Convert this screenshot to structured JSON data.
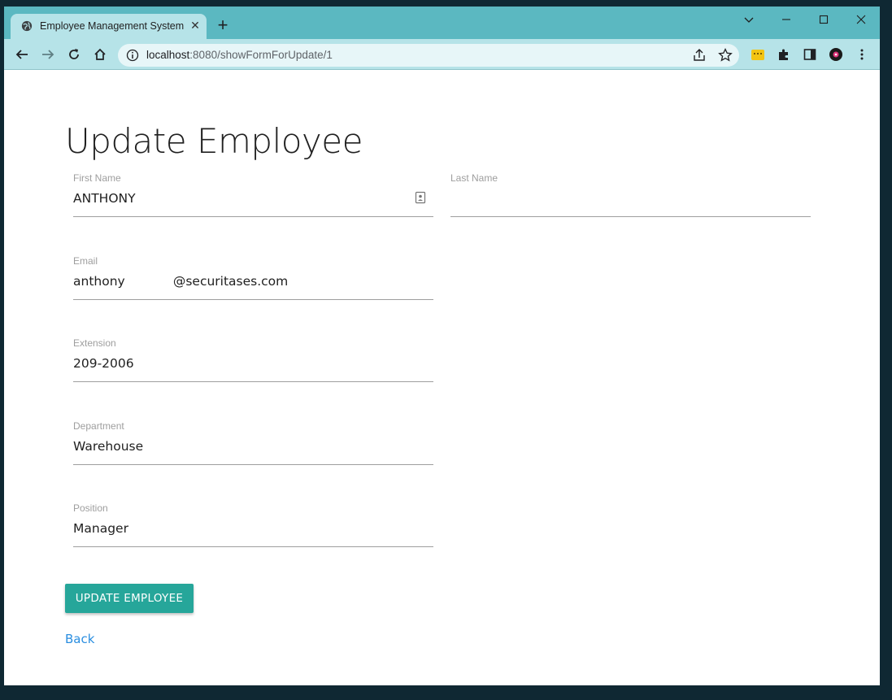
{
  "browser": {
    "tab_title": "Employee Management System",
    "url_host": "localhost",
    "url_path": ":8080/showFormForUpdate/1",
    "new_tab_symbol": "+",
    "tab_close_symbol": "✕",
    "window_controls": {
      "dropdown": "⌵",
      "minimize": "—",
      "maximize": "☐",
      "close": "✕"
    },
    "toolbar_icons": [
      "back-icon",
      "forward-icon",
      "reload-icon",
      "home-icon",
      "info-icon",
      "share-icon",
      "bookmark-star-icon",
      "extension-icon",
      "puzzle-icon",
      "sidepanel-icon",
      "profile-icon",
      "menu-icon"
    ],
    "accent_color": "#5bb8c1"
  },
  "page": {
    "title": "Update Employee",
    "fields": {
      "first_name": {
        "label": "First Name",
        "value": "ANTHONY"
      },
      "last_name": {
        "label": "Last Name",
        "value": ""
      },
      "email": {
        "label": "Email",
        "value": "anthony            @securitases.com"
      },
      "extension": {
        "label": "Extension",
        "value": "209-2006"
      },
      "department": {
        "label": "Department",
        "value": "Warehouse"
      },
      "position": {
        "label": "Position",
        "value": "Manager"
      }
    },
    "update_button": "UPDATE EMPLOYEE",
    "update_button_color": "#26a69a",
    "back_link": "Back",
    "link_color": "#2a8ee0"
  }
}
